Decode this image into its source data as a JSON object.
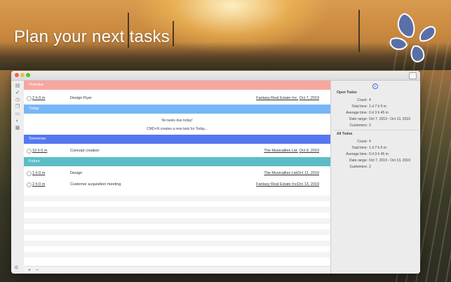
{
  "promo": {
    "headline": "Plan your next tasks"
  },
  "colors": {
    "overdue": "#f7a6a0",
    "today": "#76b6f7",
    "tomorrow": "#5578f2",
    "future": "#5bbec6",
    "logo": "#5a6fa8"
  },
  "window": {
    "sections": {
      "overdue": "Overdue",
      "today": "Today",
      "tomorrow": "Tomorrow",
      "future": "Future"
    },
    "today_empty": {
      "line1": "No tasks due today!",
      "line2": "CMD+N creates a new task for Today..."
    },
    "tasks": [
      {
        "duration": "2 h 0 m",
        "name": "Design Flyer",
        "customer": "Fantasy Real Estate Inc.",
        "date": "Oct 7, 2019"
      },
      {
        "duration": "10 h 0 m",
        "name": "Concept creation",
        "customer": "The Musicallies Ltd.",
        "date": "Oct 9, 2019"
      },
      {
        "duration": "1 h 0 m",
        "name": "Design",
        "customer": "The Musicallies Ltd.",
        "date": "Oct 11, 2019"
      },
      {
        "duration": "2 h 0 m",
        "name": "Customer acquisition meeting",
        "customer": "Fantasy Real Estate Inc.",
        "date": "Oct 13, 2019"
      }
    ],
    "bottombar": {
      "add": "+",
      "remove": "−"
    }
  },
  "inspector": {
    "open": {
      "heading": "Open Todos",
      "rows": [
        {
          "label": "Count:",
          "value": "4"
        },
        {
          "label": "Total time:",
          "value": "1 d 7 h 0 m"
        },
        {
          "label": "Average time:",
          "value": "0 d 3 h 45 m"
        },
        {
          "label": "Date range:",
          "value": "Oct 7, 2019 - Oct 13, 2019"
        },
        {
          "label": "Customers:",
          "value": "2"
        }
      ]
    },
    "all": {
      "heading": "All Todos",
      "rows": [
        {
          "label": "Count:",
          "value": "4"
        },
        {
          "label": "Total time:",
          "value": "1 d 7 h 0 m"
        },
        {
          "label": "Average time:",
          "value": "0 d 3 h 45 m"
        },
        {
          "label": "Date range:",
          "value": "Oct 7, 2019 - Oct 13, 2019"
        },
        {
          "label": "Customers:",
          "value": "2"
        }
      ]
    }
  }
}
